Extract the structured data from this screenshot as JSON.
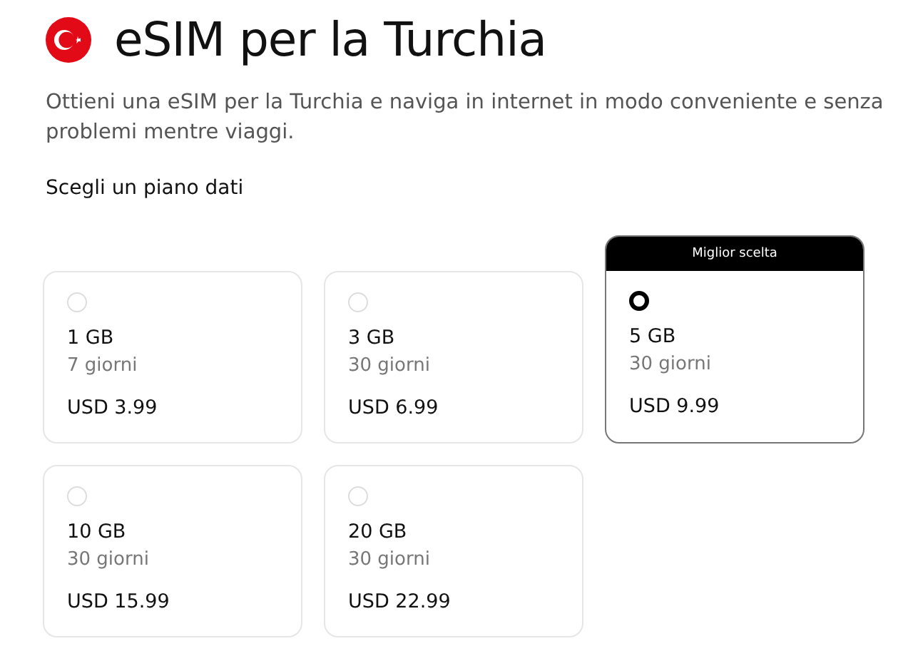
{
  "title": "eSIM per la Turchia",
  "description": "Ottieni una eSIM per la Turchia e naviga in internet in modo conveniente e senza problemi mentre viaggi.",
  "section_heading": "Scegli un piano dati",
  "plans": [
    {
      "data": "1 GB",
      "duration": "7 giorni",
      "price": "USD 3.99",
      "selected": false
    },
    {
      "data": "3 GB",
      "duration": "30 giorni",
      "price": "USD 6.99",
      "selected": false
    },
    {
      "data": "5 GB",
      "duration": "30 giorni",
      "price": "USD 9.99",
      "selected": true,
      "badge": "Miglior scelta"
    },
    {
      "data": "10 GB",
      "duration": "30 giorni",
      "price": "USD 15.99",
      "selected": false
    },
    {
      "data": "20 GB",
      "duration": "30 giorni",
      "price": "USD 22.99",
      "selected": false
    }
  ]
}
